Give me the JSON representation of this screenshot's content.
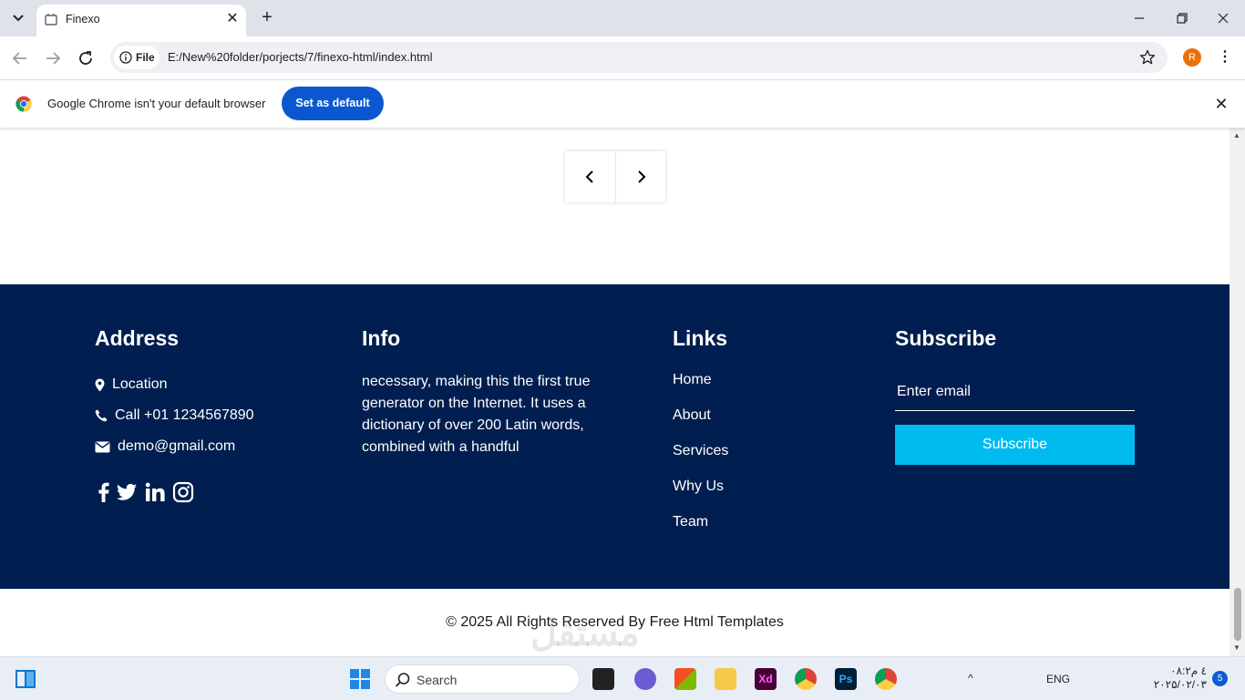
{
  "browser": {
    "tab_title": "Finexo",
    "site_chip_label": "File",
    "url": "E:/New%20folder/porjects/7/finexo-html/index.html",
    "profile_initial": "R",
    "infobar_message": "Google Chrome isn't your default browser",
    "infobar_button": "Set as default"
  },
  "footer": {
    "address": {
      "title": "Address",
      "items": [
        {
          "icon": "map-marker-icon",
          "text": "Location"
        },
        {
          "icon": "phone-icon",
          "text": "Call +01 1234567890"
        },
        {
          "icon": "envelope-icon",
          "text": "demo@gmail.com"
        }
      ],
      "social": [
        "facebook-icon",
        "twitter-icon",
        "linkedin-icon",
        "instagram-icon"
      ]
    },
    "info": {
      "title": "Info",
      "text": "necessary, making this the first true generator on the Internet. It uses a dictionary of over 200 Latin words, combined with a handful"
    },
    "links": {
      "title": "Links",
      "items": [
        "Home",
        "About",
        "Services",
        "Why Us",
        "Team"
      ]
    },
    "subscribe": {
      "title": "Subscribe",
      "placeholder": "Enter email",
      "button": "Subscribe"
    },
    "bg_color": "#001e4f",
    "accent_color": "#00bbf0"
  },
  "copyright": "© 2025 All Rights Reserved By Free Html Templates",
  "taskbar": {
    "search_label": "Search",
    "lang": "ENG",
    "time": "۰۸:۲٤ م",
    "date": "۲۰۲۵/۰۲/۰۳",
    "notification_count": "5"
  }
}
